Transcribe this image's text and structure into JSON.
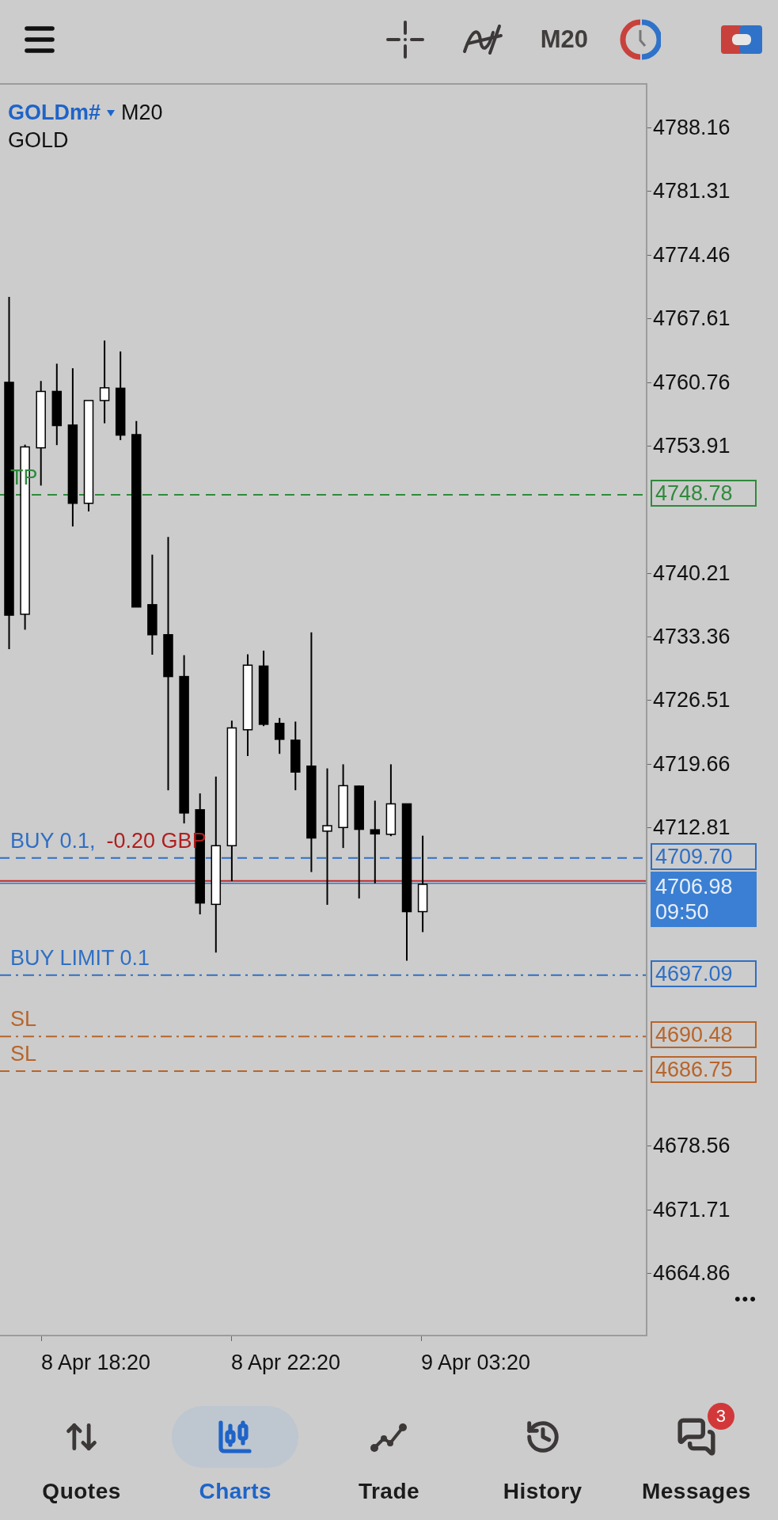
{
  "toolbar": {
    "timeframe": "M20"
  },
  "chart": {
    "symbol": "GOLDm#",
    "timeframe": "M20",
    "description": "GOLD",
    "price_axis": [
      "4788.16",
      "4781.31",
      "4774.46",
      "4767.61",
      "4760.76",
      "4753.91",
      "4740.21",
      "4733.36",
      "4726.51",
      "4719.66",
      "4712.81",
      "4678.56",
      "4671.71",
      "4664.86"
    ],
    "levels": [
      {
        "kind": "tp",
        "label": "TP",
        "price": "4748.78",
        "color": "#2f8a3c"
      },
      {
        "kind": "position",
        "label": "BUY 0.1,",
        "profit": "-0.20 GBP",
        "price": "4709.70",
        "color": "#2f6fc4"
      },
      {
        "kind": "limit",
        "label": "BUY LIMIT 0.1",
        "price": "4697.09",
        "color": "#2f6fc4"
      },
      {
        "kind": "sl",
        "label": "SL",
        "price": "4690.48",
        "color": "#b8652a"
      },
      {
        "kind": "sl",
        "label": "SL",
        "price": "4686.75",
        "color": "#b8652a"
      }
    ],
    "bid": {
      "price": "4706.98",
      "time": "09:50"
    },
    "more": "•••",
    "time_axis": [
      "8 Apr 18:20",
      "8 Apr 22:20",
      "9 Apr 03:20"
    ]
  },
  "nav": [
    {
      "label": "Quotes",
      "selected": false
    },
    {
      "label": "Charts",
      "selected": true
    },
    {
      "label": "Trade",
      "selected": false
    },
    {
      "label": "History",
      "selected": false
    },
    {
      "label": "Messages",
      "selected": false,
      "badge": "3"
    }
  ]
}
